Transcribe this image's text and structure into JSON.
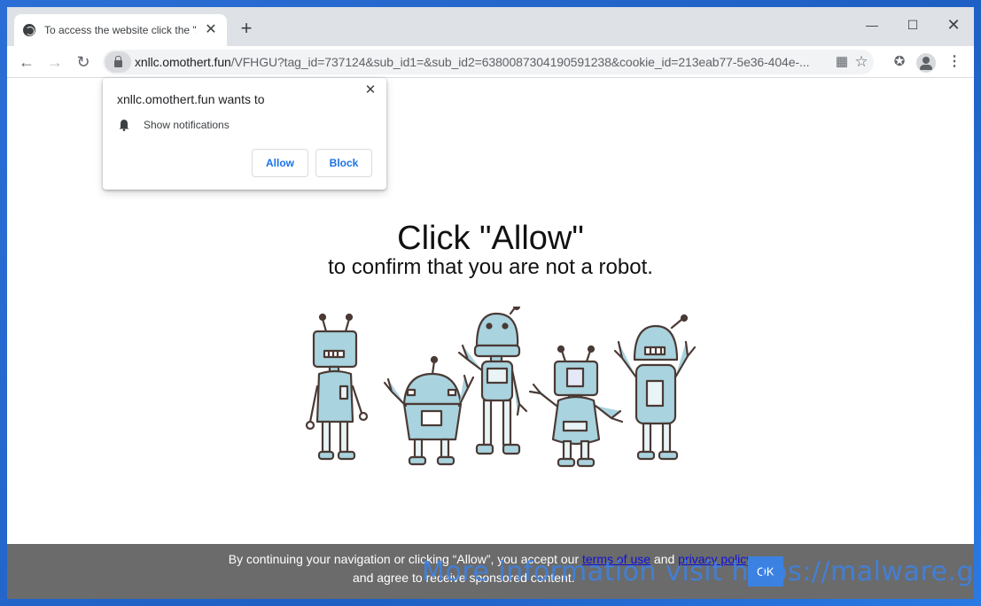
{
  "browser": {
    "tab_title": "To access the website click the \"A",
    "new_tab_symbol": "+",
    "window_controls": {
      "minimize": "—",
      "maximize": "☐",
      "close": "✕"
    },
    "url_domain": "xnllc.omothert.fun",
    "url_path": "/VFHGU?tag_id=737124&sub_id1=&sub_id2=6380087304190591238&cookie_id=213eab77-5e36-404e-...",
    "icons": [
      "back-arrow",
      "forward-arrow",
      "reload",
      "lock",
      "qr-code",
      "star",
      "puzzle-piece",
      "profile",
      "kebab-menu"
    ]
  },
  "notification_prompt": {
    "title": "xnllc.omothert.fun wants to",
    "permission": "Show notifications",
    "allow_label": "Allow",
    "block_label": "Block",
    "close_symbol": "✕"
  },
  "page": {
    "headline": "Click \"Allow\"",
    "subline": "to confirm that you are not a robot.",
    "robot_color": "#a9d3de"
  },
  "consent": {
    "line1_prefix": "By continuing your navigation or clicking “Allow”, you accept our ",
    "terms_link": "terms of use",
    "and_text": " and ",
    "privacy_link": "privacy policy",
    "line2": "and agree to receive sponsored content.",
    "ok_label": "OK"
  },
  "watermark": "More information visit https://malware.guide"
}
